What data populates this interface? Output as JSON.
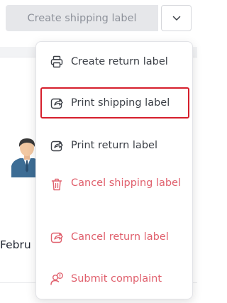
{
  "split_button": {
    "label": "Create shipping label",
    "toggle_icon": "chevron-down-icon"
  },
  "menu": {
    "items": [
      {
        "label": "Create return label",
        "icon": "printer-icon",
        "color": "#3b3f46"
      },
      {
        "label": "Print shipping label",
        "icon": "share-out-icon",
        "color": "#3b3f46",
        "highlighted": true
      },
      {
        "label": "Print return label",
        "icon": "share-out-icon",
        "color": "#3b3f46"
      },
      {
        "label": "Cancel shipping label",
        "icon": "trash-icon",
        "color": "#e0606d"
      },
      {
        "label": "Cancel return label",
        "icon": "share-out-icon",
        "color": "#e0606d"
      },
      {
        "label": "Submit complaint",
        "icon": "user-alert-icon",
        "color": "#e0606d"
      }
    ]
  },
  "background": {
    "partial_text": "Febru",
    "highlight_color": "#d61f2c"
  }
}
